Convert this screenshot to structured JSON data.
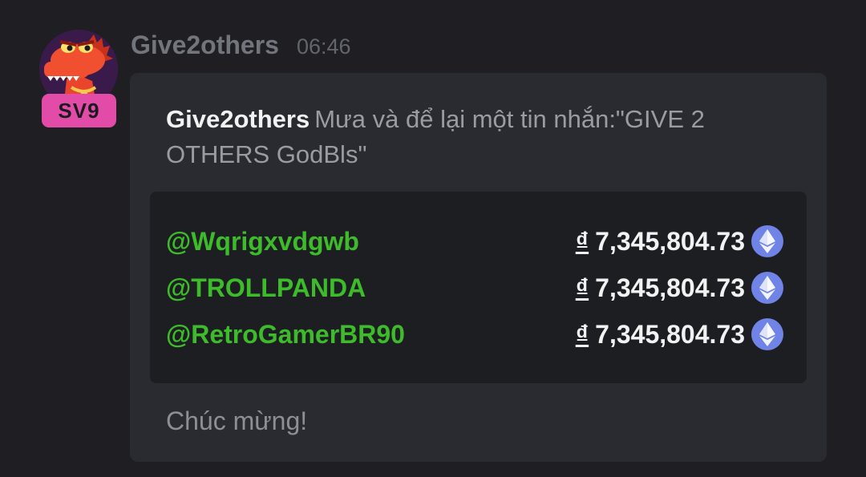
{
  "message": {
    "sender": "Give2others",
    "time": "06:46",
    "badge": "SV9",
    "avatar_icon": "crocodile-avatar-icon"
  },
  "card": {
    "announce_sender": "Give2others",
    "announce_text": "Mưa và để lại một tin nhắn:\"GIVE 2 OTHERS GodBls\"",
    "recipients": [
      {
        "user": "@Wqrigxvdgwb",
        "currency": "₫",
        "amount": "7,345,804.73",
        "icon": "ethereum-icon"
      },
      {
        "user": "@TROLLPANDA",
        "currency": "₫",
        "amount": "7,345,804.73",
        "icon": "ethereum-icon"
      },
      {
        "user": "@RetroGamerBR90",
        "currency": "₫",
        "amount": "7,345,804.73",
        "icon": "ethereum-icon"
      }
    ],
    "footer": "Chúc mừng!"
  },
  "colors": {
    "background": "#1f1f23",
    "card": "#2a2b30",
    "list": "#1d1e22",
    "username": "#3dbb2b",
    "badge": "#e24ca8",
    "eth": "#6f84e6"
  }
}
